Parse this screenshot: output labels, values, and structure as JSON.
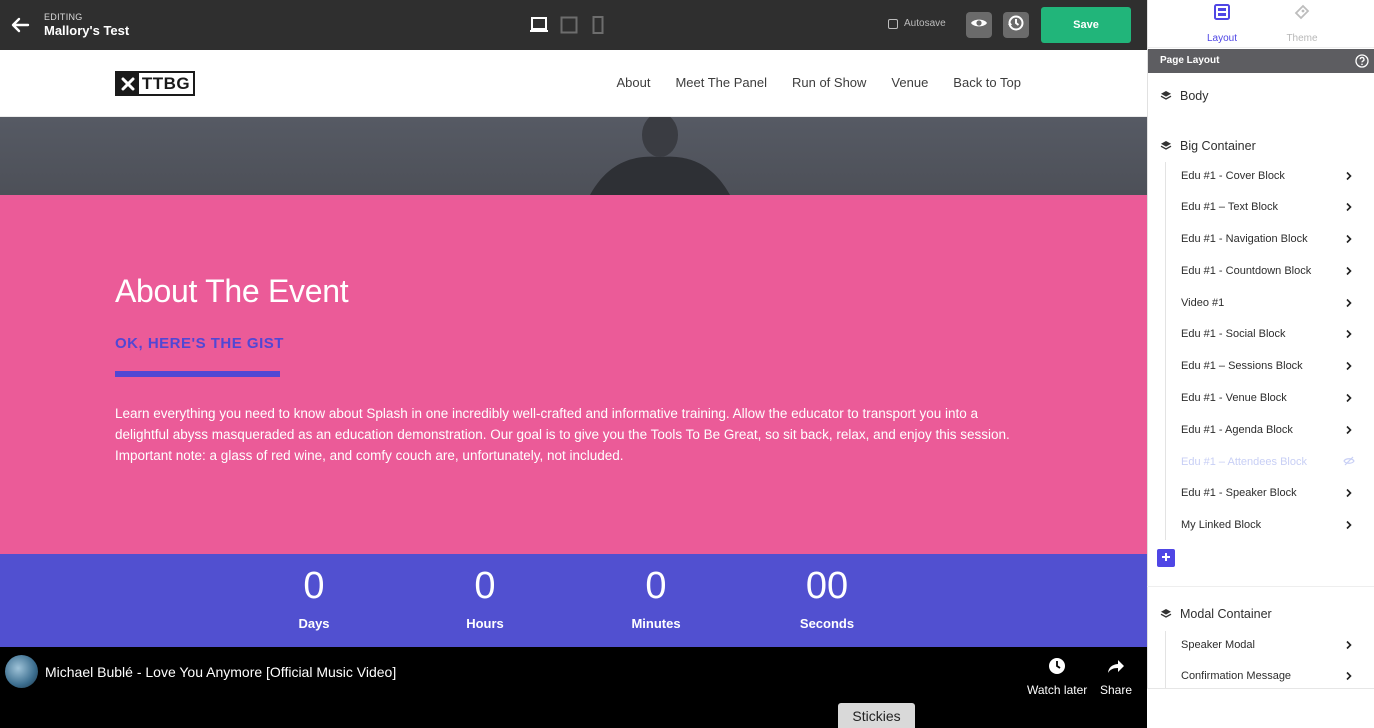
{
  "editor": {
    "editing_label": "EDITING",
    "doc_title": "Mallory's Test",
    "autosave_label": "Autosave",
    "save_label": "Save"
  },
  "site": {
    "logo_text": "TTBG",
    "nav": [
      "About",
      "Meet The Panel",
      "Run of Show",
      "Venue",
      "Back to Top"
    ]
  },
  "about": {
    "heading": "About The Event",
    "subheading": "OK, HERE'S THE GIST",
    "body": "Learn everything you need to know about Splash in one incredibly well-crafted and informative training. Allow the educator to transport you into a delightful abyss masqueraded as an education demonstration. Our goal is to give you the Tools To Be Great, so sit back, relax, and enjoy this session. Important note: a glass of red wine, and comfy couch are, unfortunately, not included."
  },
  "countdown": [
    {
      "value": "0",
      "label": "Days"
    },
    {
      "value": "0",
      "label": "Hours"
    },
    {
      "value": "0",
      "label": "Minutes"
    },
    {
      "value": "00",
      "label": "Seconds"
    }
  ],
  "video": {
    "title": "Michael Bublé - Love You Anymore [Official Music Video]",
    "watch_later": "Watch later",
    "share": "Share"
  },
  "stickies_label": "Stickies",
  "sidebar": {
    "tabs": [
      "Layout",
      "Theme"
    ],
    "header": "Page Layout",
    "body_label": "Body",
    "big_container": {
      "label": "Big Container",
      "items": [
        {
          "label": "Edu #1 - Cover Block",
          "hidden": false
        },
        {
          "label": "Edu #1 – Text Block",
          "hidden": false
        },
        {
          "label": "Edu #1 - Navigation Block",
          "hidden": false
        },
        {
          "label": "Edu #1 - Countdown Block",
          "hidden": false
        },
        {
          "label": "Video #1",
          "hidden": false
        },
        {
          "label": "Edu #1 - Social Block",
          "hidden": false
        },
        {
          "label": "Edu #1 – Sessions Block",
          "hidden": false
        },
        {
          "label": "Edu #1 - Venue Block",
          "hidden": false
        },
        {
          "label": "Edu #1 - Agenda Block",
          "hidden": false
        },
        {
          "label": "Edu #1 – Attendees Block",
          "hidden": true
        },
        {
          "label": "Edu #1 - Speaker Block",
          "hidden": false
        },
        {
          "label": "My Linked Block",
          "hidden": false
        }
      ]
    },
    "modal_container": {
      "label": "Modal Container",
      "items": [
        {
          "label": "Speaker Modal"
        },
        {
          "label": "Confirmation Message"
        }
      ]
    }
  },
  "colors": {
    "accent": "#4f46e5",
    "save_green": "#21b57a",
    "about_bg": "#eb5b98",
    "countdown_bg": "#5150d0",
    "editor_bar": "#2f2f2f"
  }
}
